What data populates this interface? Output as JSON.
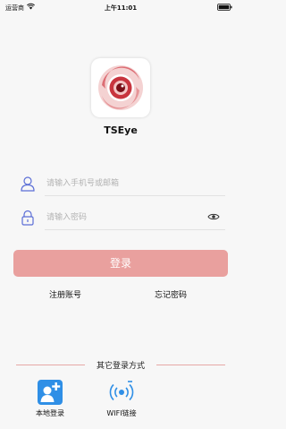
{
  "status_bar": {
    "carrier": "运营商",
    "time": "上午11:01"
  },
  "app": {
    "name": "TSEye"
  },
  "form": {
    "phone_placeholder": "请输入手机号或邮箱",
    "password_placeholder": "请输入密码",
    "login_label": "登录"
  },
  "links": {
    "register": "注册账号",
    "forgot": "忘记密码"
  },
  "other_login": {
    "title": "其它登录方式",
    "items": [
      {
        "label": "本地登录",
        "icon": "local-user-add-icon"
      },
      {
        "label": "WIFI链接",
        "icon": "wifi-broadcast-icon"
      }
    ]
  },
  "colors": {
    "accent": "#e9a09e",
    "logo_red": "#c8343e",
    "icon_blue": "#2f8fe6"
  }
}
